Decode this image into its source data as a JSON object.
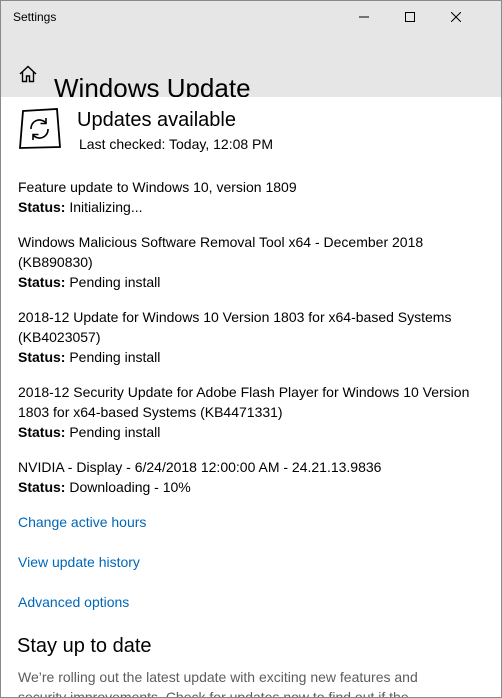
{
  "window": {
    "app_title": "Settings",
    "buttons": {
      "minimize": "minimize-icon",
      "maximize": "maximize-icon",
      "close": "close-icon"
    }
  },
  "header": {
    "home_icon": "home-icon",
    "title": "Windows Update"
  },
  "status": {
    "icon": "sync-icon",
    "title": "Updates available",
    "last_checked": "Last checked: Today, 12:08 PM"
  },
  "updates": [
    {
      "name": "Feature update to Windows 10, version 1809",
      "status_label": "Status:",
      "status": "Initializing..."
    },
    {
      "name": "Windows Malicious Software Removal Tool x64 - December 2018 (KB890830)",
      "status_label": "Status:",
      "status": "Pending install"
    },
    {
      "name": "2018-12 Update for Windows 10 Version 1803 for x64-based Systems (KB4023057)",
      "status_label": "Status:",
      "status": "Pending install"
    },
    {
      "name": "2018-12 Security Update for Adobe Flash Player for Windows 10 Version 1803 for x64-based Systems (KB4471331)",
      "status_label": "Status:",
      "status": "Pending install"
    },
    {
      "name": "NVIDIA - Display - 6/24/2018 12:00:00 AM - 24.21.13.9836",
      "status_label": "Status:",
      "status": "Downloading - 10%"
    }
  ],
  "links": {
    "active_hours": "Change active hours",
    "history": "View update history",
    "advanced": "Advanced options"
  },
  "stay_up_to_date": {
    "title": "Stay up to date",
    "description": "We’re rolling out the latest update with exciting new features and security improvements. Check for updates now to find out if the"
  },
  "colors": {
    "link": "#0067b8",
    "header_bg": "#e6e6e6"
  }
}
